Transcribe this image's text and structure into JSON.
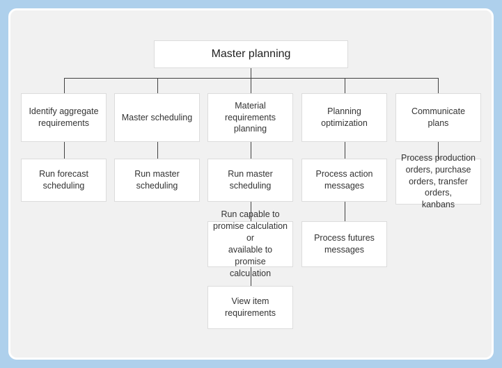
{
  "diagram": {
    "title": "Master planning",
    "type": "process-flow-hierarchy",
    "colors": {
      "page_background": "#aed0ec",
      "panel_background": "#f1f1f1",
      "node_background": "#ffffff",
      "node_border": "#dcdcdc",
      "connector": "#404040",
      "text": "#333333"
    },
    "root": {
      "label": "Master planning"
    },
    "columns": [
      {
        "id": "identify-aggregate-requirements",
        "heading": "Identify aggregate\nrequirements",
        "steps": [
          {
            "id": "run-forecast-scheduling",
            "label": "Run forecast\nscheduling"
          }
        ]
      },
      {
        "id": "master-scheduling",
        "heading": "Master scheduling",
        "steps": [
          {
            "id": "run-master-scheduling",
            "label": "Run master scheduling"
          }
        ]
      },
      {
        "id": "material-requirements-planning",
        "heading": "Material requirements\nplanning",
        "steps": [
          {
            "id": "run-master-scheduling-mrp",
            "label": "Run master\nscheduling"
          },
          {
            "id": "run-capable-to-promise",
            "label": "Run capable to\npromise calculation or\navailable to promise\ncalculation"
          },
          {
            "id": "view-item-requirements",
            "label": "View item\nrequirements"
          }
        ]
      },
      {
        "id": "planning-optimization",
        "heading": "Planning\noptimization",
        "steps": [
          {
            "id": "process-action-messages",
            "label": "Process action\nmessages"
          },
          {
            "id": "process-futures-messages",
            "label": "Process futures\nmessages"
          }
        ]
      },
      {
        "id": "communicate-plans",
        "heading": "Communicate plans",
        "steps": [
          {
            "id": "process-production-orders",
            "label": "Process production\norders, purchase\norders, transfer orders,\nkanbans"
          }
        ]
      }
    ]
  }
}
